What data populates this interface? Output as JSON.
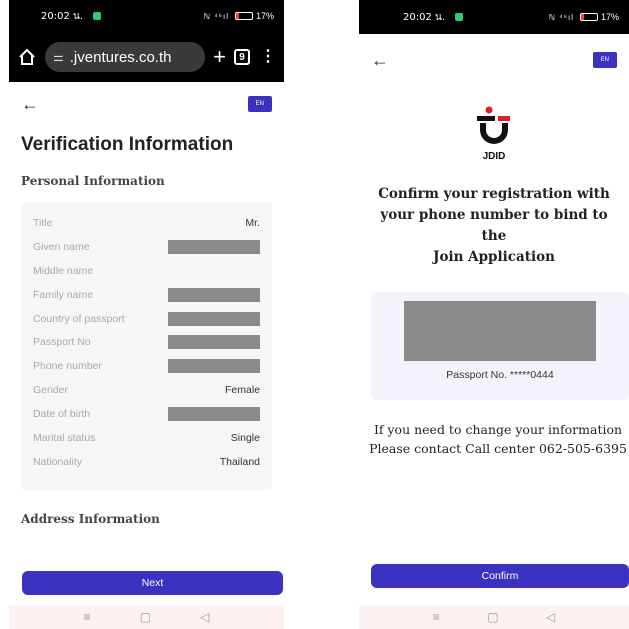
{
  "left": {
    "status": {
      "time": "20:02 น.",
      "signal": "ℕ ⁴⁶ıl",
      "battery": "17%"
    },
    "browser": {
      "url": ".jventures.co.th",
      "tab_count": "9",
      "plus": "+",
      "menu": "⋮",
      "tune": "⚌"
    },
    "nav": {
      "back": "←",
      "lang": "EN"
    },
    "title": "Verification Information",
    "personal_section": "Personal Information",
    "rows": [
      {
        "label": "Title",
        "value": "Mr."
      },
      {
        "label": "Given name",
        "value": ""
      },
      {
        "label": "Middle name",
        "value": ""
      },
      {
        "label": "Family name",
        "value": ""
      },
      {
        "label": "Country of passport",
        "value": ""
      },
      {
        "label": "Passport No",
        "value": ""
      },
      {
        "label": "Phone number",
        "value": ""
      },
      {
        "label": "Gender",
        "value": "Female"
      },
      {
        "label": "Date of birth",
        "value": ""
      },
      {
        "label": "Marital status",
        "value": "Single"
      },
      {
        "label": "Nationality",
        "value": "Thailand"
      }
    ],
    "address_section": "Address Information",
    "next_button": "Next",
    "navbar": {
      "menu": "≡",
      "home": "▢",
      "back": "◁"
    }
  },
  "right": {
    "status": {
      "time": "20:02 น.",
      "signal": "ℕ ⁴⁶ıl",
      "battery": "17%"
    },
    "nav": {
      "back": "←",
      "lang": "EN"
    },
    "logo_text": "JDID",
    "confirm_line1": "Confirm your registration with",
    "confirm_line2": "your phone number to bind to the",
    "confirm_line3": "Join Application",
    "passport_label": "Passport No. *****0444",
    "help_line1": "If you need to change your information",
    "help_line2": "Please contact Call center 062-505-6395",
    "confirm_button": "Confirm",
    "navbar": {
      "menu": "≡",
      "home": "▢",
      "back": "◁"
    }
  },
  "colors": {
    "accent": "#3b32c2",
    "redaction": "#8a8a8a",
    "logo_red": "#e02020"
  }
}
